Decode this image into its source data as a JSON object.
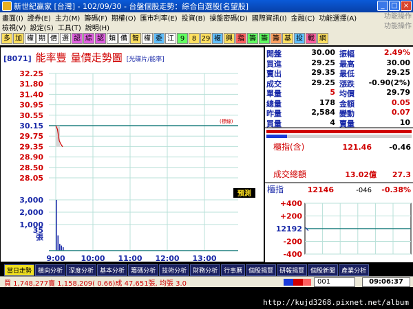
{
  "window": {
    "title": "新世紀贏家 [台灣] - 102/09/30 - 台盤個股走勢：綜合自選股[名望股]",
    "minimize": "_",
    "maximize": "□",
    "close": "×"
  },
  "menu1": [
    "畫面(I)",
    "證券(E)",
    "主力(M)",
    "籌碼(F)",
    "期權(O)",
    "匯市利率(E)",
    "投資(B)",
    "操盤密碼(D)",
    "國際資訊(I)",
    "金融(C)",
    "功能選擇(A)"
  ],
  "menu1_right": "功能操作",
  "menu2": [
    "檢視(V)",
    "設定(S)",
    "工具(T)",
    "說明(H)"
  ],
  "menu2_right": "功能操作",
  "toolbar": [
    "多",
    "加",
    "權",
    "期",
    "價",
    "選",
    "認",
    "綜",
    "認",
    "類",
    "備",
    "智",
    "權",
    "委",
    "江",
    "9",
    "8",
    "29",
    "複",
    "興",
    "指",
    "籌",
    "籌",
    "籌",
    "基",
    "投",
    "戰",
    "網"
  ],
  "stock": {
    "code": "[8071]",
    "name": "能率豐",
    "chart_title": "量價走勢圖",
    "sub": "[光碟片/能率]"
  },
  "price_chart": {
    "price_ticks": [
      "32.25",
      "31.80",
      "31.40",
      "30.95",
      "30.55",
      "30.15",
      "29.75",
      "29.35",
      "28.90",
      "28.50",
      "28.05"
    ],
    "ref_label": "(標線)",
    "volume_ticks": [
      "3,000",
      "2,000",
      "1,000",
      "張"
    ],
    "volume_ticks_extra": "35",
    "time_ticks": [
      "9:00",
      "10:00",
      "11:00",
      "12:00",
      "13:00"
    ],
    "forecast_label": "預測"
  },
  "chart_data": {
    "type": "line",
    "x": [
      "9:00",
      "9:05",
      "9:10",
      "9:15",
      "9:20"
    ],
    "series": [
      {
        "values": [
          30.15,
          30.0,
          29.55,
          29.4,
          29.3
        ]
      }
    ],
    "volume": [
      3000,
      900,
      400,
      300,
      200
    ],
    "ylim": [
      28.05,
      32.25
    ],
    "reference": 30.15
  },
  "quote": [
    {
      "l1": "開盤",
      "v1": "30.00",
      "l2": "振幅",
      "v2": "2.49%",
      "c1": "#000000",
      "c2": "#d00000"
    },
    {
      "l1": "買進",
      "v1": "29.25",
      "l2": "最高",
      "v2": "30.00",
      "c1": "#000000",
      "c2": "#000000"
    },
    {
      "l1": "賣出",
      "v1": "29.35",
      "l2": "最低",
      "v2": "29.25",
      "c1": "#000000",
      "c2": "#000000"
    },
    {
      "l1": "成交",
      "v1": "29.25",
      "l2": "漲跌",
      "v2": "-0.90(2%)",
      "c1": "#000000",
      "c2": "#000000"
    },
    {
      "l1": "單量",
      "v1": "5",
      "l2": "均價",
      "v2": "29.79",
      "c1": "#d00000",
      "c2": "#000000"
    },
    {
      "l1": "總量",
      "v1": "178",
      "l2": "金額",
      "v2": "0.05",
      "c1": "#000000",
      "c2": "#d00000"
    },
    {
      "l1": "昨量",
      "v1": "2,584",
      "l2": "變動",
      "v2": "0.07",
      "c1": "#000000",
      "c2": "#d00000"
    },
    {
      "l1": "買量",
      "v1": "4",
      "l2": "賣量",
      "v2": "10",
      "c1": "#000000",
      "c2": "#000000"
    }
  ],
  "index_info": {
    "label": "櫃指(含)",
    "value": "121.46",
    "change": "-0.46",
    "total_label": "成交總額",
    "total_value": "13.02億",
    "total_change": "27.3"
  },
  "index_chart": {
    "label": "櫃指",
    "value": "12146",
    "change": "-046",
    "pct": "-0.38%",
    "ticks": [
      "+400",
      "+200",
      "12192",
      "-200",
      "-400"
    ]
  },
  "tabs": [
    "當日走勢",
    "橫向分析",
    "深度分析",
    "基本分析",
    "籌碼分析",
    "技術分析",
    "財務分析",
    "行事曆",
    "個股揭覽",
    "研報揭覽",
    "個股新聞",
    "產業分析"
  ],
  "status": {
    "ticker": "買 1,748,277賣 1,158,209( 0.66)成 47,651張, 均張 3.0",
    "num": "001",
    "time": "09:06:37"
  },
  "url": "http://kujd3268.pixnet.net/album",
  "colors": {
    "up": "#d00000",
    "label_blue": "#1a2aa8",
    "bg_dark": "#000000"
  }
}
